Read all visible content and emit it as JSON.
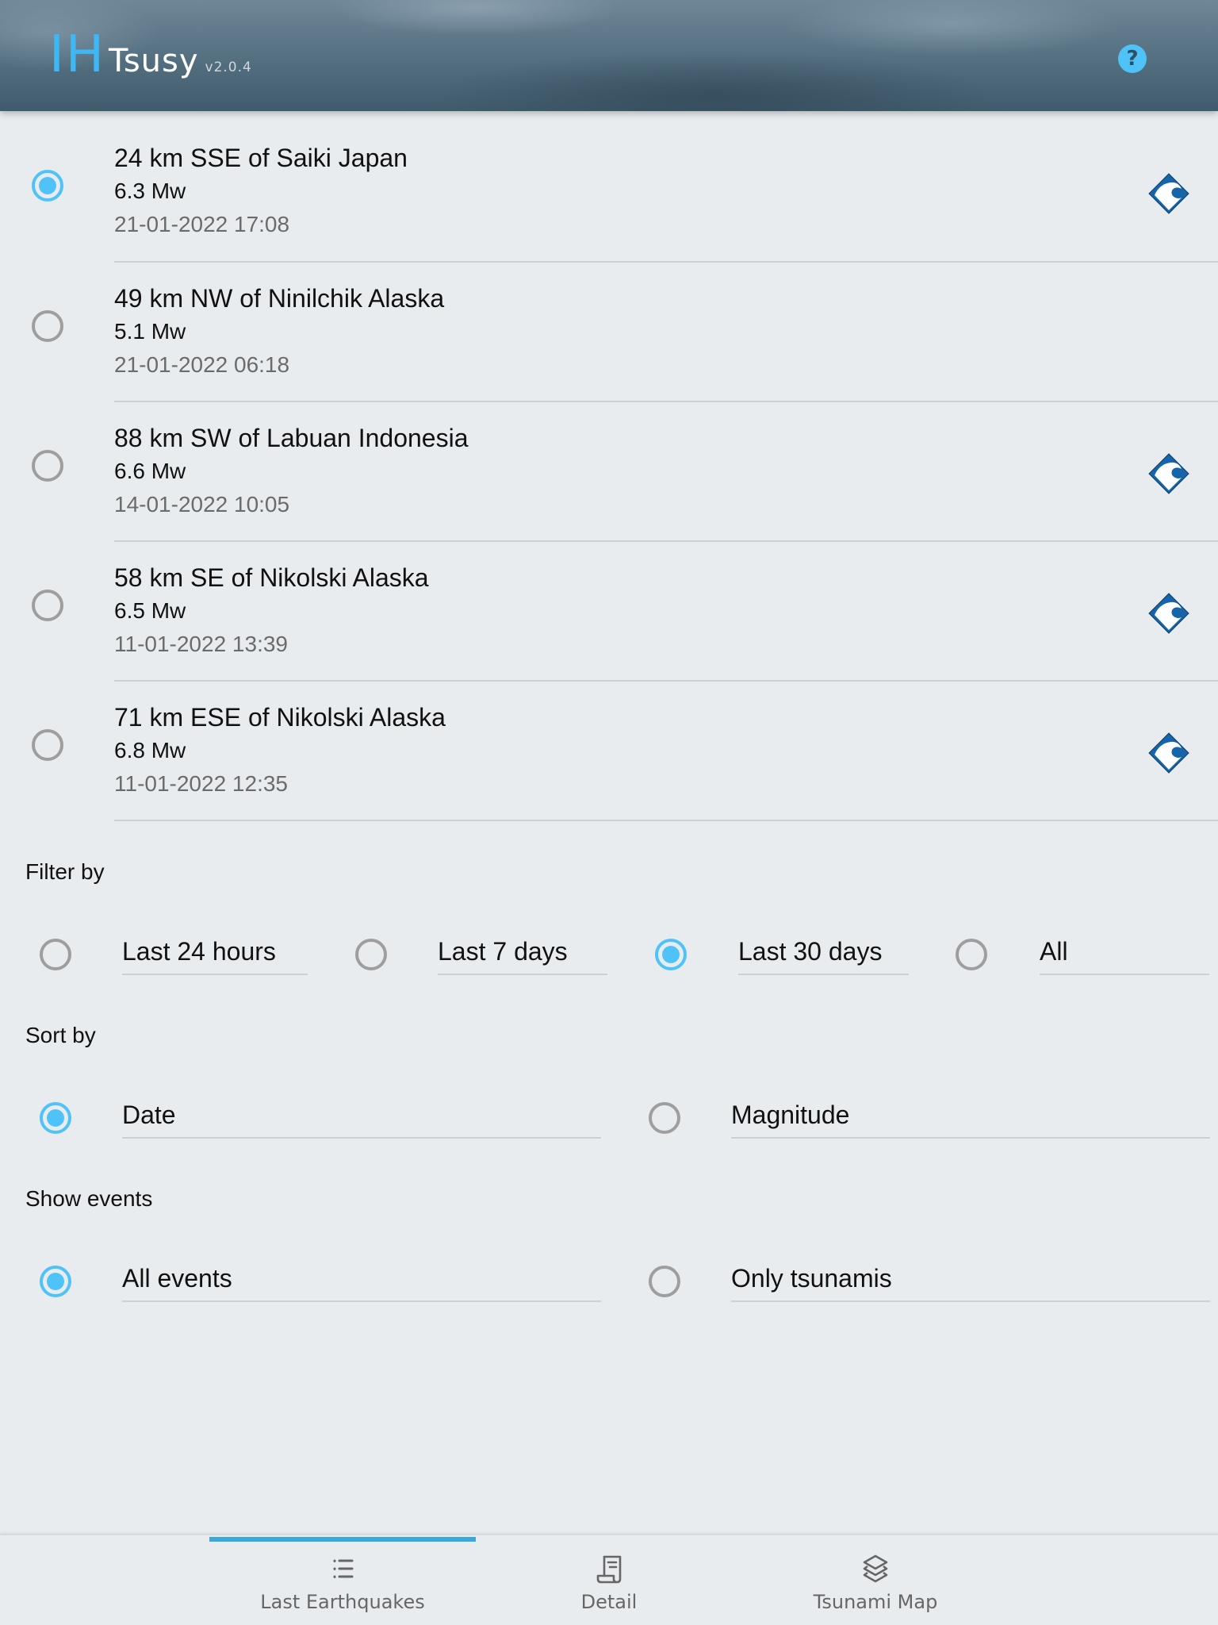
{
  "header": {
    "logo_mark": "IH",
    "app_name": "Tsusy",
    "version": "v2.0.4",
    "help_icon": "question-mark-icon",
    "help_label": "?"
  },
  "colors": {
    "accent": "#4FC3F7",
    "logo_accent": "#3DB8F5",
    "tsunami_icon": "#1565A8",
    "tab_indicator": "#3AA8DB",
    "background": "#E9ECEF"
  },
  "earthquakes": [
    {
      "location": "24 km SSE of Saiki Japan",
      "magnitude": "6.3 Mw",
      "datetime": "21-01-2022 17:08",
      "selected": true,
      "tsunami": true
    },
    {
      "location": "49 km NW of Ninilchik Alaska",
      "magnitude": "5.1 Mw",
      "datetime": "21-01-2022 06:18",
      "selected": false,
      "tsunami": false
    },
    {
      "location": "88 km SW of Labuan Indonesia",
      "magnitude": "6.6 Mw",
      "datetime": "14-01-2022 10:05",
      "selected": false,
      "tsunami": true
    },
    {
      "location": "58 km SE of Nikolski Alaska",
      "magnitude": "6.5 Mw",
      "datetime": "11-01-2022 13:39",
      "selected": false,
      "tsunami": true
    },
    {
      "location": "71 km ESE of Nikolski Alaska",
      "magnitude": "6.8 Mw",
      "datetime": "11-01-2022 12:35",
      "selected": false,
      "tsunami": true
    }
  ],
  "filter": {
    "label": "Filter by",
    "options": [
      {
        "label": "Last 24 hours",
        "selected": false
      },
      {
        "label": "Last 7 days",
        "selected": false
      },
      {
        "label": "Last 30 days",
        "selected": true
      },
      {
        "label": "All",
        "selected": false
      }
    ]
  },
  "sort": {
    "label": "Sort by",
    "options": [
      {
        "label": "Date",
        "selected": true
      },
      {
        "label": "Magnitude",
        "selected": false
      }
    ]
  },
  "show_events": {
    "label": "Show events",
    "options": [
      {
        "label": "All events",
        "selected": true
      },
      {
        "label": "Only tsunamis",
        "selected": false
      }
    ]
  },
  "bottom_nav": {
    "tabs": [
      {
        "label": "Last Earthquakes",
        "icon": "list-icon",
        "active": true
      },
      {
        "label": "Detail",
        "icon": "scroll-icon",
        "active": false
      },
      {
        "label": "Tsunami Map",
        "icon": "layers-icon",
        "active": false
      }
    ]
  }
}
